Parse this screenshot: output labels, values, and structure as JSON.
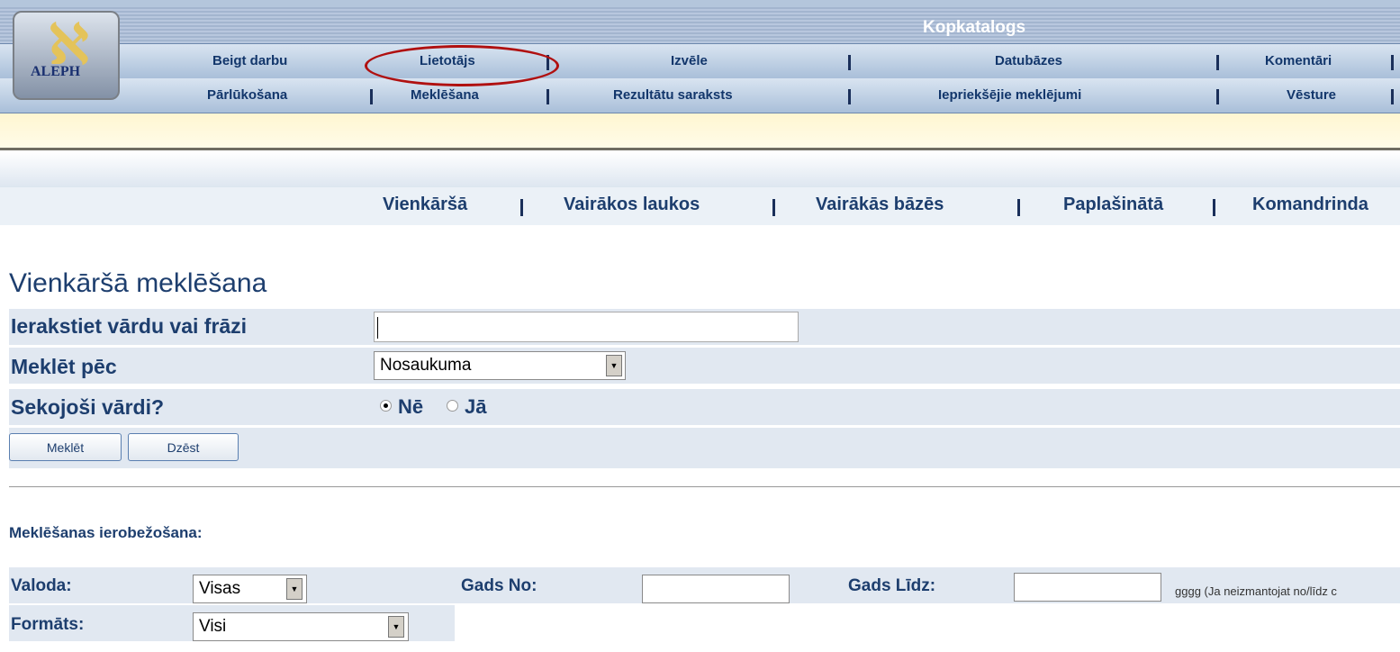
{
  "header": {
    "title": "Kopkatalogs",
    "logo_text": "ALEPH",
    "nav_row1": [
      "Beigt darbu",
      "Lietotājs",
      "Izvēle",
      "Datubāzes",
      "Komentāri"
    ],
    "nav_row2": [
      "Pārlūkošana",
      "Meklēšana",
      "Rezultātu saraksts",
      "Iepriekšējie meklējumi",
      "Vēsture"
    ]
  },
  "tabs": [
    "Vienkāršā",
    "Vairākos laukos",
    "Vairākās bāzēs",
    "Paplašinātā",
    "Komandrinda"
  ],
  "search": {
    "title": "Vienkāršā meklēšana",
    "word_label": "Ierakstiet vārdu vai frāzi",
    "word_value": "",
    "field_label": "Meklēt pēc",
    "field_value": "Nosaukuma",
    "adjacent_label": "Sekojoši vārdi?",
    "opt_no": "Nē",
    "opt_yes": "Jā",
    "search_button": "Meklēt",
    "clear_button": "Dzēst"
  },
  "limits": {
    "heading": "Meklēšanas ierobežošana:",
    "lang_label": "Valoda:",
    "lang_value": "Visas",
    "year_from_label": "Gads No:",
    "year_to_label": "Gads Līdz:",
    "year_hint": "gggg (Ja neizmantojat no/līdz c",
    "format_label": "Formāts:",
    "format_value": "Visi"
  },
  "colors": {
    "accent": "#1d3e6e",
    "highlight": "#b01010"
  }
}
